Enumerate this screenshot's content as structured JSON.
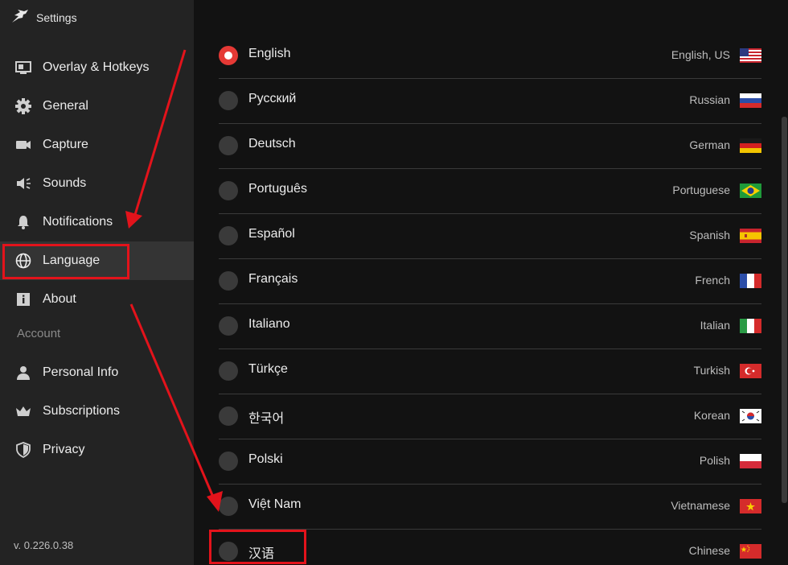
{
  "window": {
    "title": "Settings"
  },
  "titlebar_controls": {
    "help": "?",
    "minimize": "—",
    "close": "✕"
  },
  "sidebar": {
    "items": [
      {
        "label": "Overlay & Hotkeys",
        "icon": "overlay-icon"
      },
      {
        "label": "General",
        "icon": "gear-icon"
      },
      {
        "label": "Capture",
        "icon": "camera-icon"
      },
      {
        "label": "Sounds",
        "icon": "speaker-icon"
      },
      {
        "label": "Notifications",
        "icon": "bell-icon"
      },
      {
        "label": "Language",
        "icon": "globe-icon",
        "active": true
      },
      {
        "label": "About",
        "icon": "info-icon"
      }
    ],
    "account_section": "Account",
    "account_items": [
      {
        "label": "Personal Info",
        "icon": "person-icon"
      },
      {
        "label": "Subscriptions",
        "icon": "crown-icon"
      },
      {
        "label": "Privacy",
        "icon": "shield-icon"
      }
    ],
    "version": "v. 0.226.0.38"
  },
  "languages": [
    {
      "native": "English",
      "english": "English, US",
      "flag": "us-flag-icon",
      "selected": true
    },
    {
      "native": "Русский",
      "english": "Russian",
      "flag": "russia-flag-icon",
      "selected": false
    },
    {
      "native": "Deutsch",
      "english": "German",
      "flag": "germany-flag-icon",
      "selected": false
    },
    {
      "native": "Português",
      "english": "Portuguese",
      "flag": "brazil-flag-icon",
      "selected": false
    },
    {
      "native": "Español",
      "english": "Spanish",
      "flag": "spain-flag-icon",
      "selected": false
    },
    {
      "native": "Français",
      "english": "French",
      "flag": "france-flag-icon",
      "selected": false
    },
    {
      "native": "Italiano",
      "english": "Italian",
      "flag": "italy-flag-icon",
      "selected": false
    },
    {
      "native": "Türkçe",
      "english": "Turkish",
      "flag": "turkey-flag-icon",
      "selected": false
    },
    {
      "native": "한국어",
      "english": "Korean",
      "flag": "korea-flag-icon",
      "selected": false
    },
    {
      "native": "Polski",
      "english": "Polish",
      "flag": "poland-flag-icon",
      "selected": false
    },
    {
      "native": "Việt Nam",
      "english": "Vietnamese",
      "flag": "vietnam-flag-icon",
      "selected": false
    },
    {
      "native": "汉语",
      "english": "Chinese",
      "flag": "china-flag-icon",
      "selected": false
    }
  ],
  "colors": {
    "accent": "#e53935",
    "annotation": "#e3131b",
    "sidebar_bg": "#232323",
    "main_bg": "#121212"
  }
}
